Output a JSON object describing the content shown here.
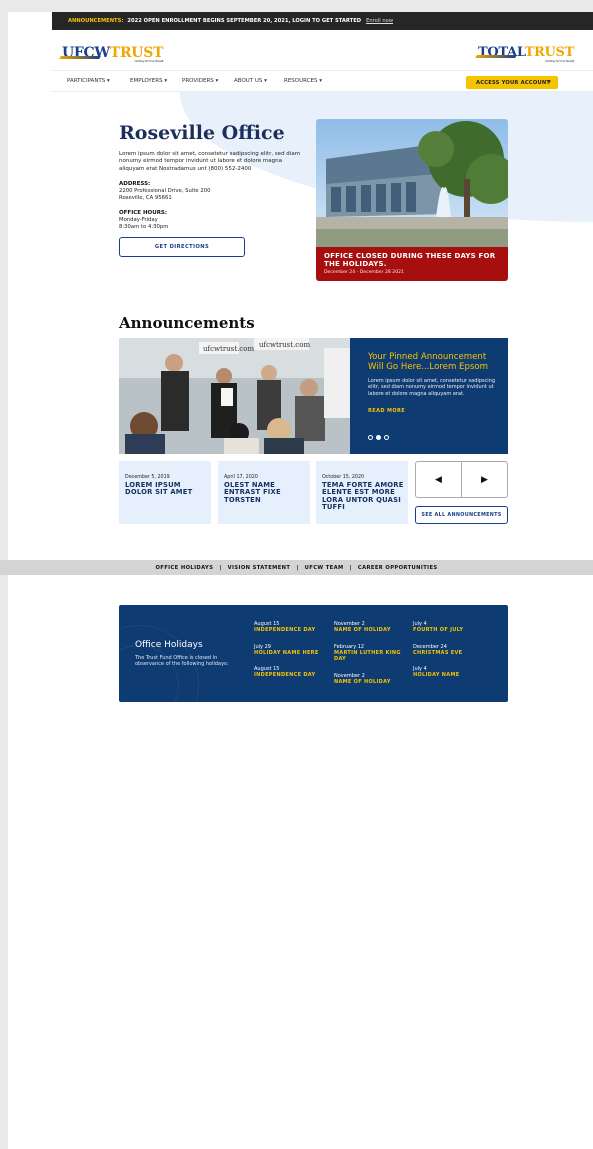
{
  "announcement_bar": {
    "label": "ANNOUNCEMENTS:",
    "text": "2022 OPEN ENROLLMENT BEGINS SEPTEMBER 20, 2021, LOGIN TO GET STARTED",
    "link": "Enroll now"
  },
  "header": {
    "logo_left": {
      "part1": "UFCW",
      "part2": "TRUST",
      "tagline": "Working For Your Benefit"
    },
    "logo_right": {
      "part1": "TOTAL",
      "part2": "TRUST",
      "tagline": "Working For Your Benefit"
    }
  },
  "nav": {
    "items": [
      "PARTICIPANTS ▾",
      "EMPLOYERS ▾",
      "PROVIDERS ▾",
      "ABOUT US ▾",
      "RESOURCES ▾"
    ],
    "account_button": "ACCESS YOUR ACCOUNT",
    "account_caret": "▾"
  },
  "office": {
    "title": "Roseville Office",
    "description": "Lorem ipsum dolor sit amet, consetetur sadipscing elitr, sed diam nonumy eirmod tempor invidunt ut labore et dolore magna aliquyam erat Nostradamus unt (800) 552-2400",
    "address_label": "ADDRESS:",
    "address_line1": "2200 Professional Drive, Suite 200",
    "address_line2": "Roseville, CA 95661",
    "hours_label": "OFFICE HOURS:",
    "hours_line1": "Monday-Friday",
    "hours_line2": "8:30am to 4:30pm",
    "directions_button": "GET DIRECTIONS",
    "closure_title": "OFFICE CLOSED DURING THESE DAYS FOR THE HOLIDAYS.",
    "closure_dates": "December 24 - December 28 2021"
  },
  "announcements": {
    "title": "Announcements",
    "photo_signs": [
      "ufcwtrust.com",
      "ufcwtrust.com"
    ],
    "pinned_title": "Your Pinned Announcement Will Go Here...Lorem Epsom",
    "pinned_body": "Lorem ipsum dolor sit amet, consetetur sadipscing elitr, sed diam nonumy eirmod tempor invidunt ut labore et dolore magna aliquyam erat.",
    "read_more": "READ MORE",
    "cards": [
      {
        "date": "December 5, 2019",
        "headline": "LOREM IPSUM DOLOR SIT AMET"
      },
      {
        "date": "April 17, 2020",
        "headline": "OLEST NAME ENTRAST FIXE TORSTEN"
      },
      {
        "date": "October 15, 2020",
        "headline": "TEMA FORTE AMORE ELENTE EST MORE LORA UNTOR QUASI TUFFI"
      }
    ],
    "prev_icon": "◀",
    "next_icon": "▶",
    "see_all": "SEE ALL ANNOUNCEMENTS"
  },
  "links_band": [
    "OFFICE HOLIDAYS",
    "VISION STATEMENT",
    "UFCW TEAM",
    "CAREER OPPORTUNITIES"
  ],
  "link_separator": "|",
  "holidays": {
    "title": "Office Holidays",
    "description": "The Trust Fund Office is closed in observance of the following holidays:",
    "entries": [
      {
        "date": "August 15",
        "name": "INDEPENDENCE DAY"
      },
      {
        "date": "July 29",
        "name": "HOLIDAY NAME HERE"
      },
      {
        "date": "August 15",
        "name": "INDEPENDENCE DAY"
      },
      {
        "date": "November 2",
        "name": "NAME OF HOLIDAY"
      },
      {
        "date": "February 12",
        "name": "MARTIN LUTHER KING DAY"
      },
      {
        "date": "November 2",
        "name": "NAME OF HOLIDAY"
      },
      {
        "date": "July 4",
        "name": "FOURTH OF JULY"
      },
      {
        "date": "December 24",
        "name": "CHRISTMAS EVE"
      },
      {
        "date": "July 4",
        "name": "HOLIDAY NAME"
      }
    ]
  },
  "colors": {
    "navy": "#0f3b73",
    "gold": "#f5c400",
    "alert_red": "#a70e0e",
    "light_blue": "#e5f0fc"
  }
}
